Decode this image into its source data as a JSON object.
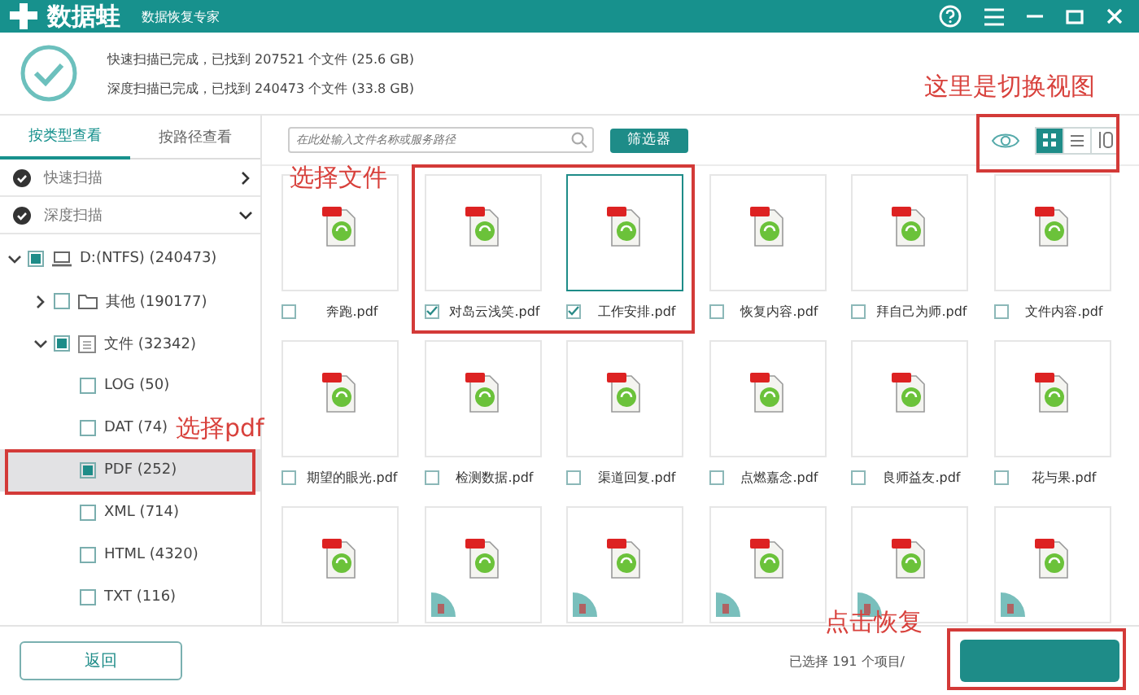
{
  "window": {
    "app_name": "数据蛙",
    "subtitle": "数据恢复专家"
  },
  "scan_summary": [
    "快速扫描已完成，已找到 207521 个文件 (25.6 GB)",
    "深度扫描已完成，已找到 240473 个文件 (33.8 GB)"
  ],
  "tabs": [
    {
      "label": "按类型查看",
      "selected": true
    },
    {
      "label": "按路径查看",
      "selected": false
    }
  ],
  "scans": [
    {
      "label": "快速扫描",
      "expanded": false
    },
    {
      "label": "深度扫描",
      "expanded": true
    }
  ],
  "tree": [
    {
      "label": "D:(NTFS) (240473)",
      "kind": "drive",
      "expanded": true,
      "checked": true,
      "selected": false,
      "children": [
        {
          "label": "其他 (190177)",
          "kind": "folder",
          "expanded": false,
          "checked": false,
          "selected": false
        },
        {
          "label": "文件 (32342)",
          "kind": "document",
          "expanded": true,
          "checked": true,
          "selected": false,
          "children": [
            {
              "label": "LOG (50)",
              "checked": false,
              "selected": false
            },
            {
              "label": "DAT (74)",
              "checked": false,
              "selected": false
            },
            {
              "label": "PDF (252)",
              "checked": true,
              "selected": true
            },
            {
              "label": "XML (714)",
              "checked": false,
              "selected": false
            },
            {
              "label": "HTML (4320)",
              "checked": false,
              "selected": false
            },
            {
              "label": "TXT (116)",
              "checked": false,
              "selected": false
            }
          ]
        }
      ]
    }
  ],
  "search": {
    "placeholder": "在此处输入文件名称或服务路径"
  },
  "filter_button": "筛选器",
  "views": [
    {
      "kind": "grid",
      "selected": true
    },
    {
      "kind": "list",
      "selected": false
    },
    {
      "kind": "detail",
      "selected": false
    }
  ],
  "files": [
    {
      "name": "奔跑.pdf",
      "checked": false,
      "selected": false,
      "deleted": false
    },
    {
      "name": "对岛云浅笑.pdf",
      "checked": true,
      "selected": false,
      "deleted": false
    },
    {
      "name": "工作安排.pdf",
      "checked": true,
      "selected": true,
      "deleted": false
    },
    {
      "name": "恢复内容.pdf",
      "checked": false,
      "selected": false,
      "deleted": false
    },
    {
      "name": "拜自己为师.pdf",
      "checked": false,
      "selected": false,
      "deleted": false
    },
    {
      "name": "文件内容.pdf",
      "checked": false,
      "selected": false,
      "deleted": false
    },
    {
      "name": "期望的眼光.pdf",
      "checked": false,
      "selected": false,
      "deleted": false
    },
    {
      "name": "检测数据.pdf",
      "checked": false,
      "selected": false,
      "deleted": false
    },
    {
      "name": "渠道回复.pdf",
      "checked": false,
      "selected": false,
      "deleted": false
    },
    {
      "name": "点燃嘉念.pdf",
      "checked": false,
      "selected": false,
      "deleted": false
    },
    {
      "name": "良师益友.pdf",
      "checked": false,
      "selected": false,
      "deleted": false
    },
    {
      "name": "花与果.pdf",
      "checked": false,
      "selected": false,
      "deleted": false
    },
    {
      "selected": false,
      "deleted": false
    },
    {
      "selected": false,
      "deleted": true
    },
    {
      "selected": false,
      "deleted": true
    },
    {
      "selected": false,
      "deleted": true
    },
    {
      "selected": false,
      "deleted": true
    },
    {
      "selected": false,
      "deleted": true
    }
  ],
  "back_button": "返回",
  "status": "已选择 191 个项目/",
  "annotations": [
    "这里是切换视图",
    "选择文件",
    "选择pdf",
    "点击恢复"
  ]
}
